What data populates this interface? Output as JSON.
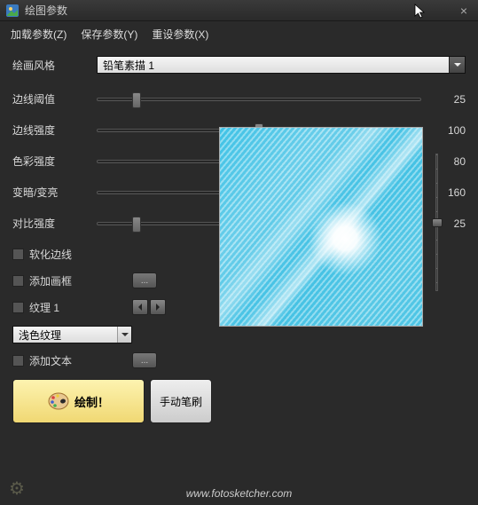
{
  "window": {
    "title": "绘图参数",
    "close_label": "×"
  },
  "menu": {
    "load": "加载参数(Z)",
    "save": "保存参数(Y)",
    "reset": "重设参数(X)"
  },
  "style": {
    "label": "绘画风格",
    "value": "铅笔素描 1"
  },
  "sliders": [
    {
      "label": "边线阈值",
      "value": 25,
      "max": 255,
      "pct": 12
    },
    {
      "label": "边线强度",
      "value": 100,
      "max": 200,
      "pct": 50
    },
    {
      "label": "色彩强度",
      "value": 80,
      "max": 100,
      "pct": 80
    },
    {
      "label": "变暗/变亮",
      "value": 160,
      "max": 200,
      "pct": 80
    },
    {
      "label": "对比强度",
      "value": 25,
      "max": 200,
      "pct": 12
    }
  ],
  "options": {
    "soften_edges": {
      "label": "软化边线",
      "checked": false
    },
    "add_frame": {
      "label": "添加画框",
      "checked": false
    },
    "texture": {
      "label": "纹理 1",
      "checked": false,
      "dropdown": "浅色纹理"
    },
    "add_text": {
      "label": "添加文本",
      "checked": false
    }
  },
  "buttons": {
    "draw": "绘制！",
    "manual_brush": "手动笔刷",
    "settings_ellipsis": "..."
  },
  "preview": {
    "vertical_slider_pct": 50
  },
  "footer": {
    "url": "www.fotosketcher.com"
  }
}
